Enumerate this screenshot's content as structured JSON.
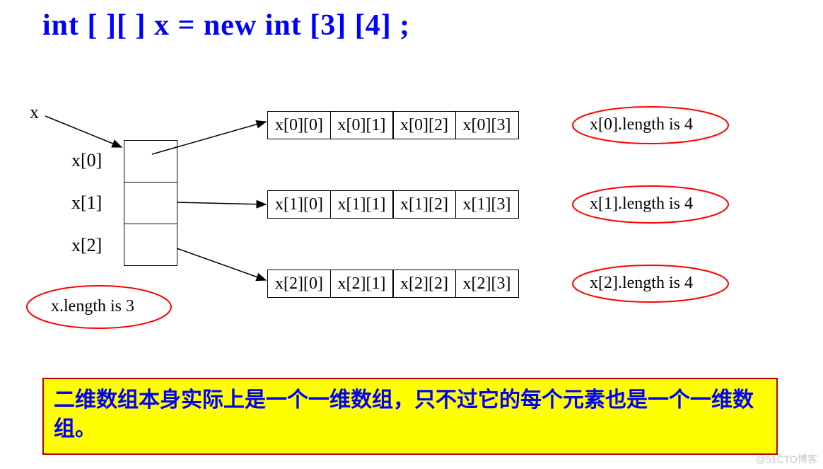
{
  "title": "int [ ][ ]  x = new int [3] [4] ;",
  "labels": {
    "x": "x",
    "x0": "x[0]",
    "x1": "x[1]",
    "x2": "x[2]"
  },
  "rows": [
    [
      "x[0][0]",
      "x[0][1]",
      "x[0][2]",
      "x[0][3]"
    ],
    [
      "x[1][0]",
      "x[1][1]",
      "x[1][2]",
      "x[1][3]"
    ],
    [
      "x[2][0]",
      "x[2][1]",
      "x[2][2]",
      "x[2][3]"
    ]
  ],
  "ellipses": {
    "xlen": "x.length is 3",
    "r0": "x[0].length is 4",
    "r1": "x[1].length is 4",
    "r2": "x[2].length is 4"
  },
  "note": "二维数组本身实际上是一个一维数组，只不过它的每个元素也是一个一维数组。",
  "watermark": "@51CTO博客"
}
